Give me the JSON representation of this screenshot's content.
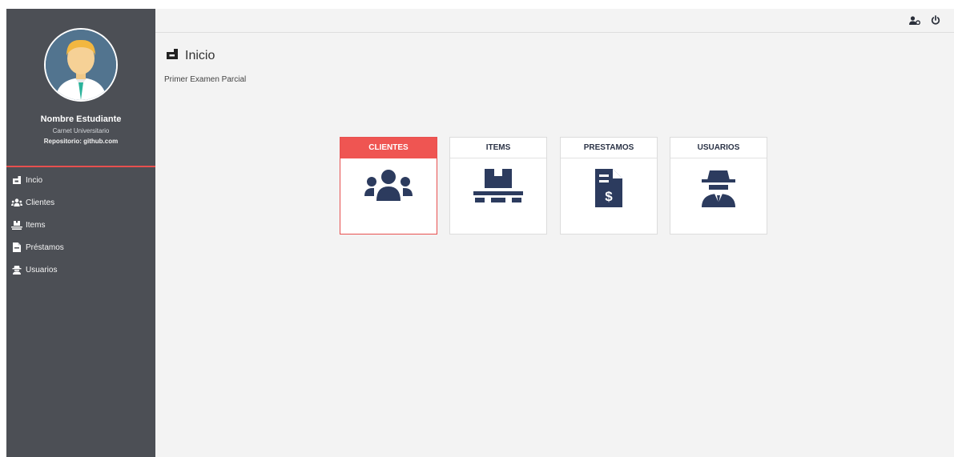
{
  "colors": {
    "sidebar_bg": "#4c4f55",
    "accent": "#ef5552",
    "icon_navy": "#2c3b5e",
    "page_bg": "#f3f3f3"
  },
  "profile": {
    "name": "Nombre Estudiante",
    "id_label": "Carnet Universitario",
    "repo": "Repositorio: github.com"
  },
  "sidebar": {
    "items": [
      {
        "label": "Incio",
        "icon": "dashboard-icon"
      },
      {
        "label": "Clientes",
        "icon": "users-icon"
      },
      {
        "label": "Items",
        "icon": "pallet-icon"
      },
      {
        "label": "Préstamos",
        "icon": "invoice-dollar-icon"
      },
      {
        "label": "Usuarios",
        "icon": "user-secret-icon"
      }
    ]
  },
  "topbar": {
    "icons": [
      "user-cog-icon",
      "power-icon"
    ]
  },
  "page": {
    "title": "Inicio",
    "subtitle": "Primer Examen Parcial"
  },
  "cards": [
    {
      "label": "CLIENTES",
      "icon": "users-icon",
      "active": true
    },
    {
      "label": "ITEMS",
      "icon": "pallet-icon",
      "active": false
    },
    {
      "label": "PRESTAMOS",
      "icon": "invoice-dollar-icon",
      "active": false
    },
    {
      "label": "USUARIOS",
      "icon": "user-secret-icon",
      "active": false
    }
  ]
}
